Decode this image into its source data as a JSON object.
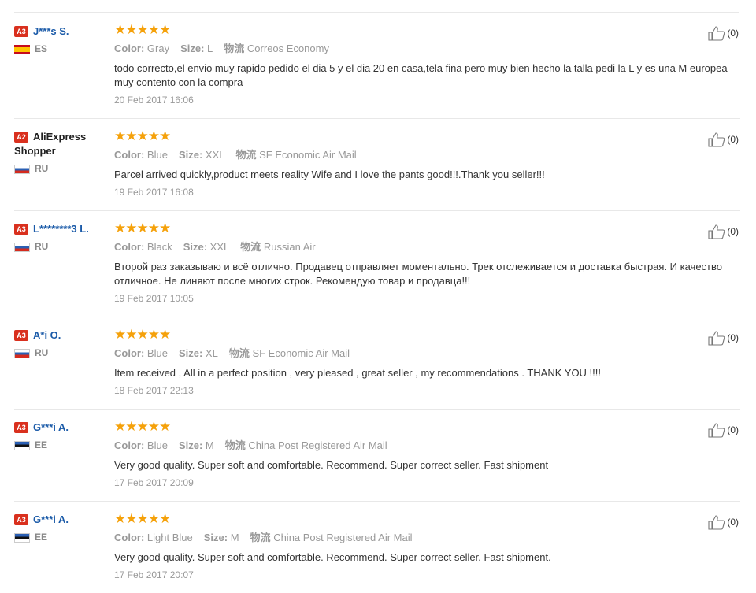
{
  "labels": {
    "color": "Color:",
    "size": "Size:",
    "shipping": "物流"
  },
  "accent_color": "#f5a10a",
  "level_color": "#d9301e",
  "reviews": [
    {
      "level": "A3",
      "name": "J***s S.",
      "country": "ES",
      "stars": "★★★★★",
      "rating": 5,
      "color": "Gray",
      "size": "L",
      "shipping": "Correos Economy",
      "text": "todo correcto,el envio muy rapido pedido el dia 5 y el dia 20 en casa,tela fina pero muy bien hecho la talla pedi la L y es una M europea muy contento con la compra",
      "date": "20 Feb 2017 16:06",
      "helpful": "(0)"
    },
    {
      "level": "A2",
      "name": "AliExpress Shopper",
      "country": "RU",
      "stars": "★★★★★",
      "rating": 5,
      "color": "Blue",
      "size": "XXL",
      "shipping": "SF Economic Air Mail",
      "text": "Parcel arrived quickly,product meets reality Wife and I love the pants good!!!.Thank you seller!!!",
      "date": "19 Feb 2017 16:08",
      "helpful": "(0)"
    },
    {
      "level": "A3",
      "name": "L********3 L.",
      "country": "RU",
      "stars": "★★★★★",
      "rating": 5,
      "color": "Black",
      "size": "XXL",
      "shipping": "Russian Air",
      "text": "Второй раз заказываю и всё отлично. Продавец отправляет моментально. Трек отслеживается и доставка быстрая. И качество отличное. Не линяют после многих строк. Рекомендую товар и продавца!!!",
      "date": "19 Feb 2017 10:05",
      "helpful": "(0)"
    },
    {
      "level": "A3",
      "name": "A*i O.",
      "country": "RU",
      "stars": "★★★★★",
      "rating": 5,
      "color": "Blue",
      "size": "XL",
      "shipping": "SF Economic Air Mail",
      "text": "Item received , All in a perfect position , very pleased , great seller , my recommendations . THANK YOU !!!!",
      "date": "18 Feb 2017 22:13",
      "helpful": "(0)"
    },
    {
      "level": "A3",
      "name": "G***i A.",
      "country": "EE",
      "stars": "★★★★★",
      "rating": 5,
      "color": "Blue",
      "size": "M",
      "shipping": "China Post Registered Air Mail",
      "text": "Very good quality. Super soft and comfortable. Recommend. Super correct seller. Fast shipment",
      "date": "17 Feb 2017 20:09",
      "helpful": "(0)"
    },
    {
      "level": "A3",
      "name": "G***i A.",
      "country": "EE",
      "stars": "★★★★★",
      "rating": 5,
      "color": "Light Blue",
      "size": "M",
      "shipping": "China Post Registered Air Mail",
      "text": "Very good quality. Super soft and comfortable. Recommend. Super correct seller. Fast shipment.",
      "date": "17 Feb 2017 20:07",
      "helpful": "(0)"
    }
  ]
}
